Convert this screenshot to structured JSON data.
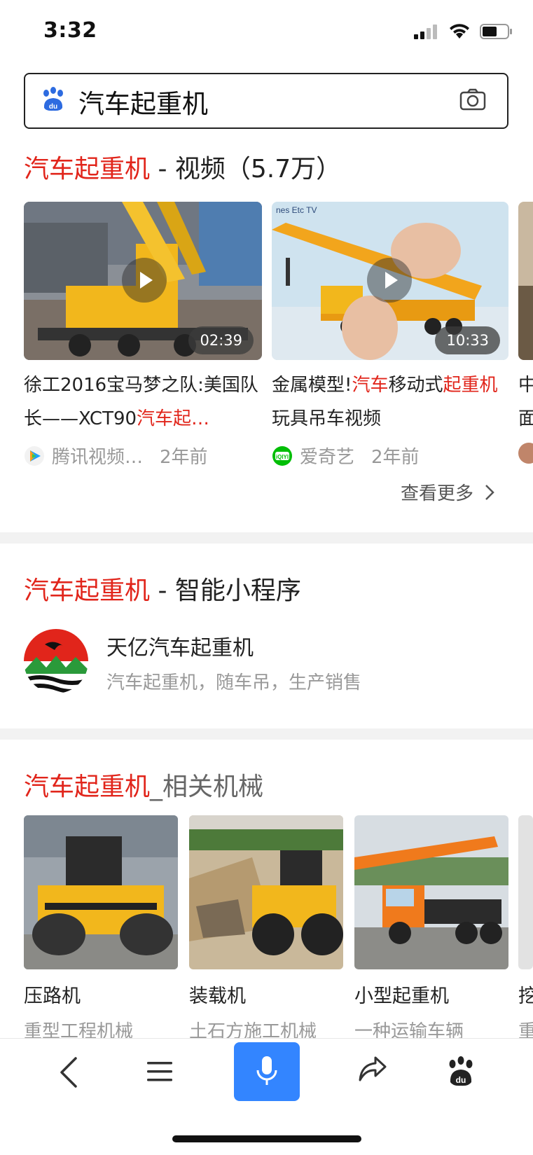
{
  "status": {
    "time": "3:32"
  },
  "search": {
    "query": "汽车起重机"
  },
  "videos_section": {
    "title_red": "汽车起重机",
    "title_rest": " - 视频（5.7万）",
    "items": [
      {
        "title_plain": "徐工2016宝马梦之队:美国队长——XCT90",
        "title_red": "汽车起…",
        "duration": "02:39",
        "source": "腾讯视频…",
        "age": "2年前"
      },
      {
        "title_plain1": "金属模型!",
        "title_red1": "汽车",
        "title_plain2": "移动式",
        "title_red2": "起重机",
        "title_plain3": "玩具吊车视频",
        "duration": "10:33",
        "source": "爱奇艺",
        "age": "2年前"
      },
      {
        "title_line1": "中",
        "title_line2": "面"
      }
    ],
    "more_label": "查看更多"
  },
  "mini_program_section": {
    "title_red": "汽车起重机",
    "title_rest": " - 智能小程序",
    "app": {
      "name": "天亿汽车起重机",
      "description": "汽车起重机，随车吊，生产销售"
    }
  },
  "machinery_section": {
    "title_red": "汽车起重机",
    "title_rest": "_相关机械",
    "items": [
      {
        "name": "压路机",
        "desc": "重型工程机械"
      },
      {
        "name": "装载机",
        "desc": "土石方施工机械"
      },
      {
        "name": "小型起重机",
        "desc": "一种运输车辆"
      },
      {
        "name": "挖",
        "desc": "重"
      }
    ]
  },
  "colors": {
    "brand_red": "#e1251b",
    "accent_blue": "#3385ff",
    "crane_yellow": "#f2b71c"
  }
}
